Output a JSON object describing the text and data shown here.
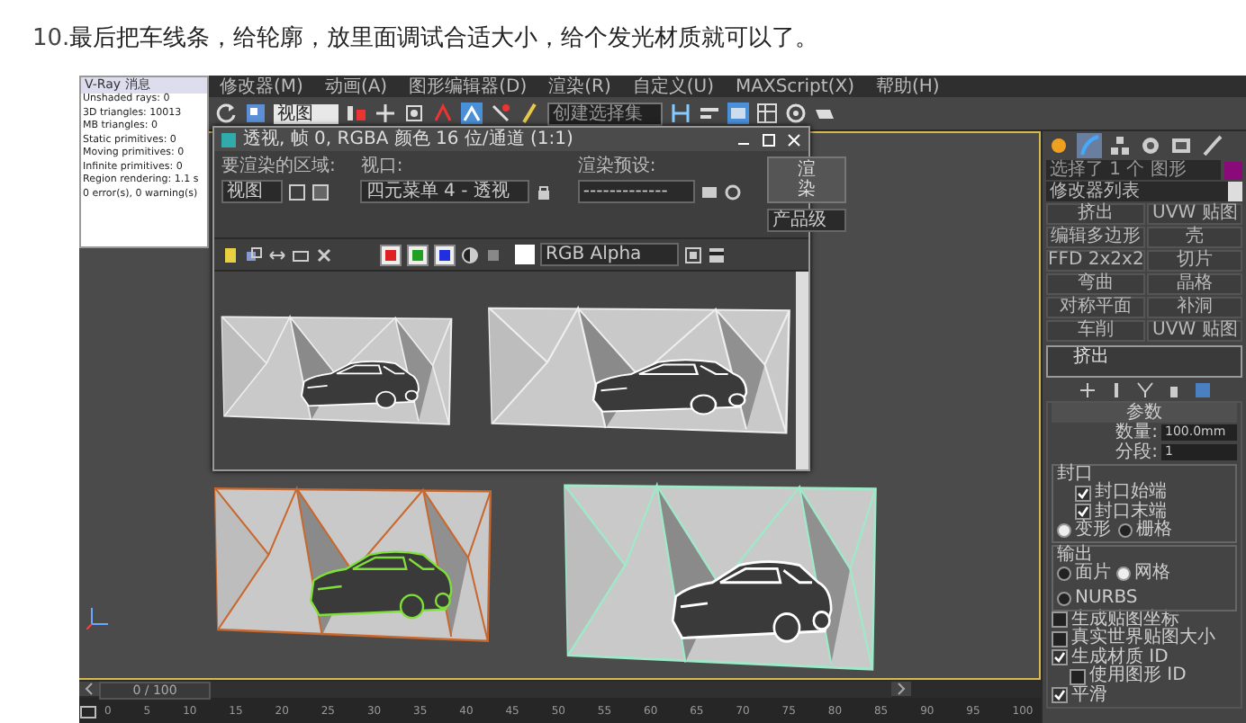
{
  "caption": {
    "number": "10.",
    "text": "最后把车线条，给轮廓，放里面调试合适大小，给个发光材质就可以了。"
  },
  "menu": [
    "修改器(M)",
    "动画(A)",
    "图形编辑器(D)",
    "渲染(R)",
    "自定义(U)",
    "MAXScript(X)",
    "帮助(H)"
  ],
  "toolbar": {
    "view_dropdown": "视图",
    "selection_set_placeholder": "创建选择集"
  },
  "vray_panel": {
    "title": "V-Ray 消息",
    "lines": [
      "Unshaded rays: 0",
      "3D triangles: 10013",
      "MB triangles: 0",
      "Static primitives: 0",
      "Moving primitives: 0",
      "Infinite primitives: 0",
      "Region rendering: 1.1 s",
      "0 error(s), 0 warning(s)"
    ]
  },
  "render_window": {
    "title": "透视, 帧 0, RGBA 颜色 16 位/通道 (1:1)",
    "area_label": "要渲染的区域:",
    "area_value": "视图",
    "viewport_label": "视口:",
    "viewport_value": "四元菜单 4 - 透视",
    "preset_label": "渲染预设:",
    "preset_value": "-------------",
    "render_button": "渲染",
    "mode_value": "产品级",
    "channels": [
      {
        "color": "#e02020",
        "checked": true
      },
      {
        "color": "#20a020",
        "checked": true
      },
      {
        "color": "#2030e0",
        "checked": true
      }
    ],
    "channel_value": "RGB Alpha"
  },
  "viewport_objects": [
    {
      "color": "#c8682e",
      "car": {
        "color": "#7fe03a"
      }
    },
    {
      "color": "#9fe8c8",
      "car": {
        "color": "#ffffff"
      }
    }
  ],
  "command_panel": {
    "tabs": [
      {
        "kind": "create",
        "selected": false
      },
      {
        "kind": "modify",
        "selected": true
      },
      {
        "kind": "hierarchy",
        "selected": false
      },
      {
        "kind": "motion",
        "selected": false
      },
      {
        "kind": "display",
        "selected": false
      },
      {
        "kind": "utilities",
        "selected": false
      }
    ],
    "object_name": "选择了 1 个 图形",
    "object_swatch": {
      "color": "#8a0a7a"
    },
    "modifier_list": "修改器列表",
    "buttons": [
      "挤出",
      "UVW 贴图",
      "编辑多边形",
      "壳",
      "FFD 2x2x2",
      "切片",
      "弯曲",
      "晶格",
      "对称平面",
      "补洞",
      "车削",
      "UVW 贴图"
    ],
    "stack": [
      {
        "label": "挤出",
        "selected": false
      }
    ],
    "rollout_title": "参数",
    "spinners": [
      {
        "label": "数量:",
        "value": "100.0mm"
      },
      {
        "label": "分段:",
        "value": "1"
      }
    ],
    "cap_group": {
      "title": "封口",
      "checks": [
        {
          "label": "封口始端",
          "checked": true
        },
        {
          "label": "封口末端",
          "checked": true
        }
      ],
      "radios": [
        {
          "label": "变形",
          "selected": true
        },
        {
          "label": "栅格",
          "selected": false
        }
      ]
    },
    "output_group": {
      "title": "输出",
      "radios": [
        {
          "label": "面片",
          "selected": false
        },
        {
          "label": "网格",
          "selected": true
        },
        {
          "label": "NURBS",
          "selected": false
        }
      ]
    },
    "options": [
      {
        "label": "生成贴图坐标",
        "checked": false
      },
      {
        "label": "真实世界贴图大小",
        "checked": false
      },
      {
        "label": "生成材质 ID",
        "checked": true
      },
      {
        "label": "使用图形 ID",
        "checked": false
      },
      {
        "label": "平滑",
        "checked": true
      }
    ]
  },
  "timeline": {
    "frame": "0 / 100",
    "level": 0,
    "ticks": [
      "0",
      "5",
      "10",
      "15",
      "20",
      "25",
      "30",
      "35",
      "40",
      "45",
      "50",
      "55",
      "60",
      "65",
      "70",
      "75",
      "80",
      "85",
      "90",
      "95",
      "100"
    ]
  }
}
